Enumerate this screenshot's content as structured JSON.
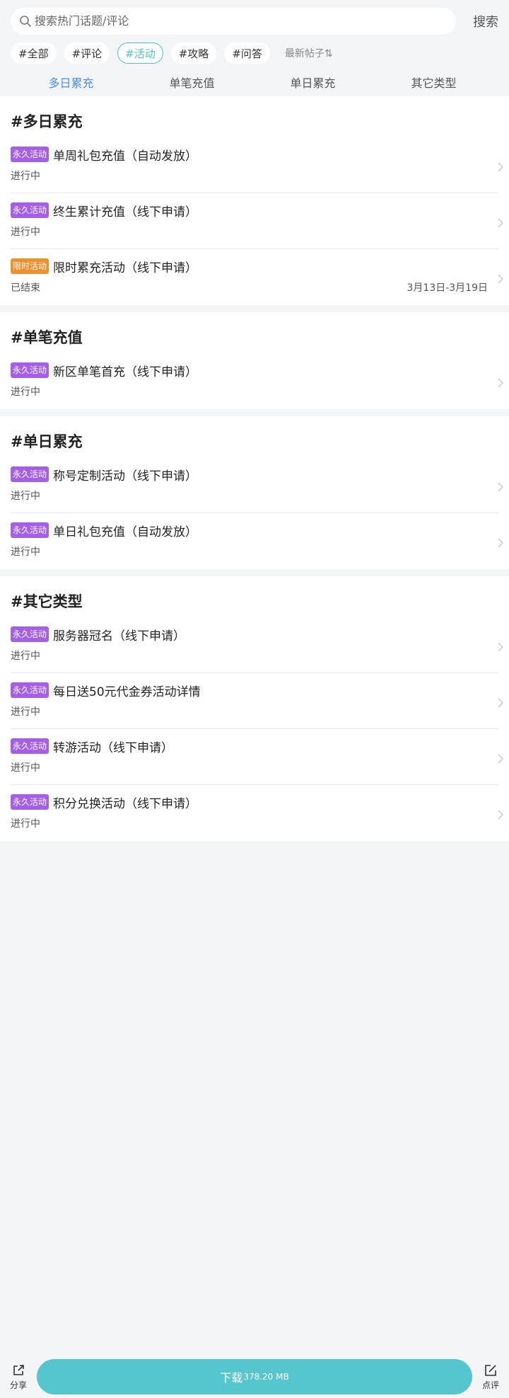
{
  "search": {
    "placeholder": "搜索热门话题/评论",
    "button": "搜索"
  },
  "tags": [
    {
      "label": "#全部",
      "active": false
    },
    {
      "label": "#评论",
      "active": false
    },
    {
      "label": "#活动",
      "active": true
    },
    {
      "label": "#攻略",
      "active": false
    },
    {
      "label": "#问答",
      "active": false
    }
  ],
  "sort_label": "最新帖子⇅",
  "sub_tabs": [
    {
      "label": "多日累充",
      "active": true
    },
    {
      "label": "单笔充值",
      "active": false
    },
    {
      "label": "单日累充",
      "active": false
    },
    {
      "label": "其它类型",
      "active": false
    }
  ],
  "sections": [
    {
      "title": "#多日累充",
      "items": [
        {
          "badge": "永久活动",
          "badge_type": "perm",
          "title": "单周礼包充值（自动发放）",
          "status": "进行中",
          "date": ""
        },
        {
          "badge": "永久活动",
          "badge_type": "perm",
          "title": "终生累计充值（线下申请）",
          "status": "进行中",
          "date": ""
        },
        {
          "badge": "限时活动",
          "badge_type": "limited",
          "title": "限时累充活动（线下申请）",
          "status": "已结束",
          "date": "3月13日-3月19日"
        }
      ]
    },
    {
      "title": "#单笔充值",
      "items": [
        {
          "badge": "永久活动",
          "badge_type": "perm",
          "title": "新区单笔首充（线下申请）",
          "status": "进行中",
          "date": ""
        }
      ]
    },
    {
      "title": "#单日累充",
      "items": [
        {
          "badge": "永久活动",
          "badge_type": "perm",
          "title": "称号定制活动（线下申请）",
          "status": "进行中",
          "date": ""
        },
        {
          "badge": "永久活动",
          "badge_type": "perm",
          "title": "单日礼包充值（自动发放）",
          "status": "进行中",
          "date": ""
        }
      ]
    },
    {
      "title": "#其它类型",
      "items": [
        {
          "badge": "永久活动",
          "badge_type": "perm",
          "title": "服务器冠名（线下申请）",
          "status": "进行中",
          "date": ""
        },
        {
          "badge": "永久活动",
          "badge_type": "perm",
          "title": "每日送50元代金券活动详情",
          "status": "进行中",
          "date": ""
        },
        {
          "badge": "永久活动",
          "badge_type": "perm",
          "title": "转游活动（线下申请）",
          "status": "进行中",
          "date": ""
        },
        {
          "badge": "永久活动",
          "badge_type": "perm",
          "title": "积分兑换活动（线下申请）",
          "status": "进行中",
          "date": ""
        }
      ]
    }
  ],
  "bottom": {
    "share": "分享",
    "download_label": "下载",
    "download_size": "378.20 MB",
    "review": "点评"
  },
  "colors": {
    "accent": "#4dc3cb",
    "tab_active": "#4a8ee8",
    "badge_perm": "#a45ee8",
    "badge_limited": "#f0902d",
    "download": "#55c6cd"
  }
}
